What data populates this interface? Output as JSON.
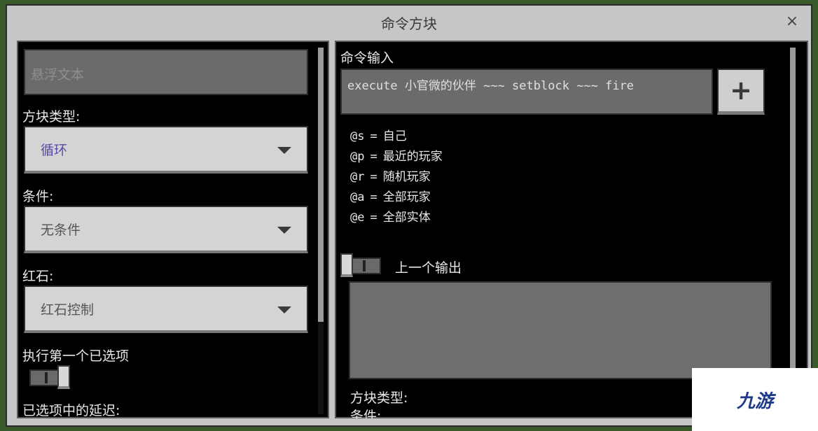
{
  "window": {
    "title": "命令方块",
    "close_label": "×"
  },
  "left_panel": {
    "hover_text_placeholder": "悬浮文本",
    "block_type_label": "方块类型:",
    "block_type_value": "循环",
    "condition_label": "条件:",
    "condition_value": "无条件",
    "redstone_label": "红石:",
    "redstone_value": "红石控制",
    "execute_first_label": "执行第一个已选项",
    "execute_first_toggle": "on",
    "delay_label": "已选项中的延迟:"
  },
  "right_panel": {
    "command_input_label": "命令输入",
    "command_value": "execute 小官微的伙伴 ~~~ setblock ~~~ fire",
    "add_button_label": "+",
    "selectors": [
      {
        "code": "@s",
        "eq": "=",
        "desc": "自己"
      },
      {
        "code": "@p",
        "eq": "=",
        "desc": "最近的玩家"
      },
      {
        "code": "@r",
        "eq": "=",
        "desc": "随机玩家"
      },
      {
        "code": "@a",
        "eq": "=",
        "desc": "全部玩家"
      },
      {
        "code": "@e",
        "eq": "=",
        "desc": "全部实体"
      }
    ],
    "previous_output_label": "上一个输出",
    "previous_output_toggle": "off",
    "bottom_block_type_label": "方块类型:",
    "bottom_condition_label": "条件:"
  },
  "watermark": {
    "text": "九游"
  },
  "colors": {
    "window_bg": "#c6c6c6",
    "panel_bg": "#000000",
    "selected_text": "#5b48a8"
  }
}
